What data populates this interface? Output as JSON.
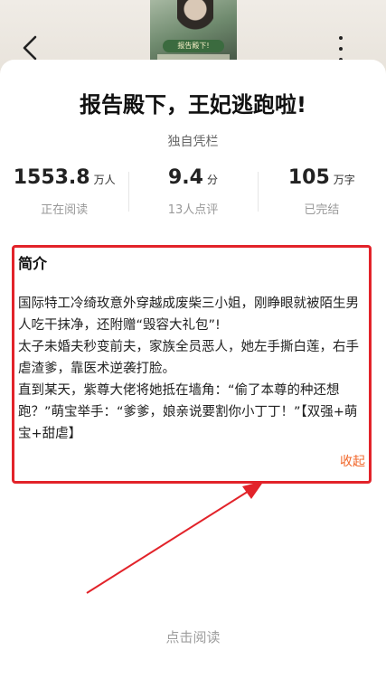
{
  "header": {
    "back_icon": "chevron-left-icon",
    "more_icon": "more-vertical-icon",
    "cover_badge": "报告殿下!"
  },
  "book": {
    "title": "报告殿下，王妃逃跑啦!",
    "author": "独自凭栏"
  },
  "stats": [
    {
      "value": "1553.8",
      "unit": "万人",
      "label": "正在阅读"
    },
    {
      "value": "9.4",
      "unit": "分",
      "label": "13人点评"
    },
    {
      "value": "105",
      "unit": "万字",
      "label": "已完结"
    }
  ],
  "intro": {
    "title": "简介",
    "paragraphs": [
      "国际特工冷绮玫意外穿越成废柴三小姐，刚睁眼就被陌生男人吃干抹净，还附赠“毁容大礼包”!",
      "太子未婚夫秒变前夫，家族全员恶人，她左手撕白莲，右手虐渣爹，靠医术逆袭打脸。",
      "直到某天，紫尊大佬将她抵在墙角：“偷了本尊的种还想跑？”萌宝举手：“爹爹，娘亲说要割你小丁丁！”【双强+萌宝+甜虐】"
    ],
    "collapse_label": "收起"
  },
  "footer": {
    "read_label": "点击阅读"
  },
  "colors": {
    "highlight_border": "#e2232a",
    "accent": "#f1672b",
    "arrow": "#e2232a"
  }
}
